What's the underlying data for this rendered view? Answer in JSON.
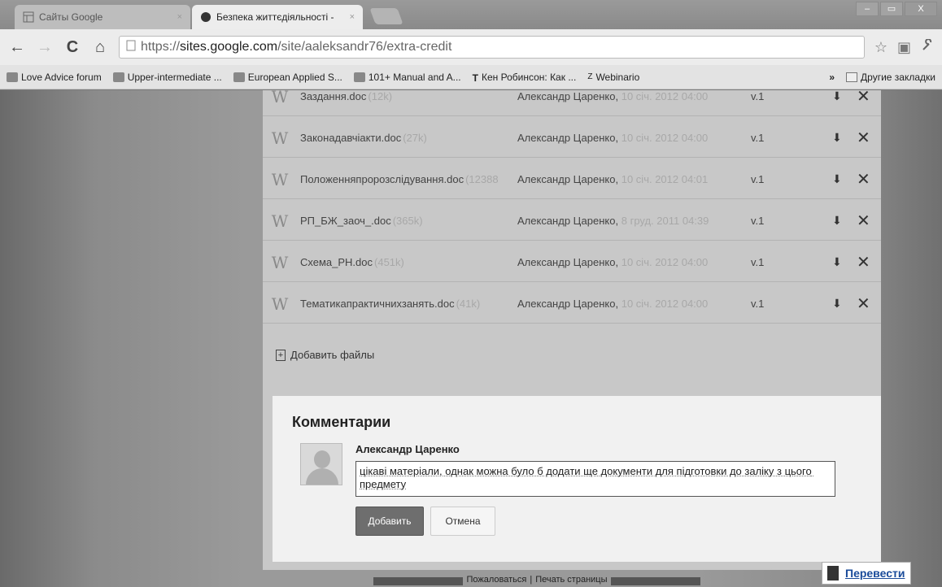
{
  "tabs": [
    {
      "label": "Сайты Google",
      "icon": "google-sites-icon",
      "close": "×"
    },
    {
      "label": "Безпека життєдіяльності -",
      "icon": "site-favicon-icon",
      "close": "×"
    }
  ],
  "window_controls": {
    "minimize": "–",
    "maximize": "▭",
    "close": "X"
  },
  "toolbar": {
    "back": "←",
    "forward": "→",
    "reload": "C",
    "home": "⌂",
    "url_prefix": "https://",
    "url_domain": "sites.google.com",
    "url_path": "/site/aaleksandr76/extra-credit",
    "star": "☆",
    "ext": "▣",
    "wrench": "🔧"
  },
  "bookmarks": [
    {
      "label": "Love Advice forum"
    },
    {
      "label": "Upper-intermediate ..."
    },
    {
      "label": "European Applied S..."
    },
    {
      "label": "101+ Manual and A..."
    },
    {
      "label": "Кен Робинсон: Как ..."
    },
    {
      "label": "Webinario"
    }
  ],
  "bookmarks_more": "»",
  "bookmarks_other": "Другие закладки",
  "files": [
    {
      "name": "Заздання.doc",
      "size": "(12k)",
      "author": "Александр Царенко,",
      "date": "10 січ. 2012 04:00",
      "version": "v.1"
    },
    {
      "name": "Законадавчіакти.doc",
      "size": "(27k)",
      "author": "Александр Царенко,",
      "date": "10 січ. 2012 04:00",
      "version": "v.1"
    },
    {
      "name": "Положенняпророзслідування.doc",
      "size": "(12388",
      "author": "Александр Царенко,",
      "date": "10 січ. 2012 04:01",
      "version": "v.1"
    },
    {
      "name": "РП_БЖ_заоч_.doc",
      "size": "(365k)",
      "author": "Александр Царенко,",
      "date": "8 груд. 2011 04:39",
      "version": "v.1"
    },
    {
      "name": "Схема_РН.doc",
      "size": "(451k)",
      "author": "Александр Царенко,",
      "date": "10 січ. 2012 04:00",
      "version": "v.1"
    },
    {
      "name": "Тематикапрактичнихзанять.doc",
      "size": "(41k)",
      "author": "Александр Царенко,",
      "date": "10 січ. 2012 04:00",
      "version": "v.1"
    }
  ],
  "file_icon_glyph": "W",
  "download_glyph": "⬇",
  "delete_glyph": "✕",
  "add_files": "Добавить файлы",
  "comments": {
    "title": "Комментарии",
    "author": "Александр Царенко",
    "text": "цікаві матеріали, однак можна було б додати ще документи для підготовки до заліку з цього предмету",
    "add_button": "Добавить",
    "cancel_button": "Отмена"
  },
  "footer": {
    "report": "Пожаловаться",
    "print": "Печать страницы"
  },
  "translate": "Перевести"
}
